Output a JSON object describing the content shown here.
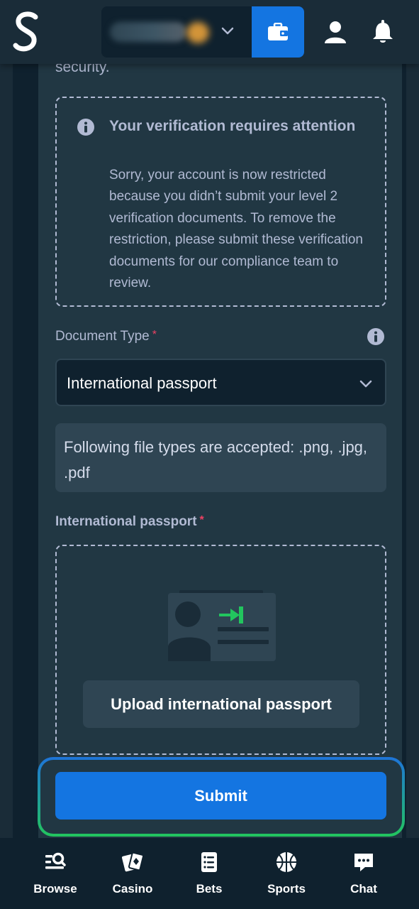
{
  "header": {
    "logo_letter": "S",
    "wallet_icon": "wallet-icon",
    "profile_icon": "user-icon",
    "notification_icon": "bell-icon"
  },
  "main": {
    "clipped_text": "security.",
    "notice": {
      "icon": "info-icon",
      "title": "Your verification requires attention",
      "body": "Sorry, your account is now restricted because you didn’t submit your level 2 verification documents. To remove the restriction, please submit these verification documents for our compliance team to review."
    },
    "document_type": {
      "label": "Document Type",
      "required_mark": "*",
      "selected": "International passport"
    },
    "file_note": "Following file types are accepted: .png, .jpg, .pdf",
    "upload": {
      "label": "International passport",
      "required_mark": "*",
      "button": "Upload international passport"
    },
    "submit": "Submit"
  },
  "nav": {
    "items": [
      {
        "label": "Browse",
        "icon": "browse-search-icon"
      },
      {
        "label": "Casino",
        "icon": "cards-icon"
      },
      {
        "label": "Bets",
        "icon": "bet-slip-icon"
      },
      {
        "label": "Sports",
        "icon": "basketball-icon"
      },
      {
        "label": "Chat",
        "icon": "chat-icon"
      }
    ]
  },
  "colors": {
    "background": "#1a2c38",
    "panel": "#213743",
    "dark": "#0f212e",
    "accent": "#1475e1",
    "required": "#ed4163",
    "success": "#22c55e"
  }
}
